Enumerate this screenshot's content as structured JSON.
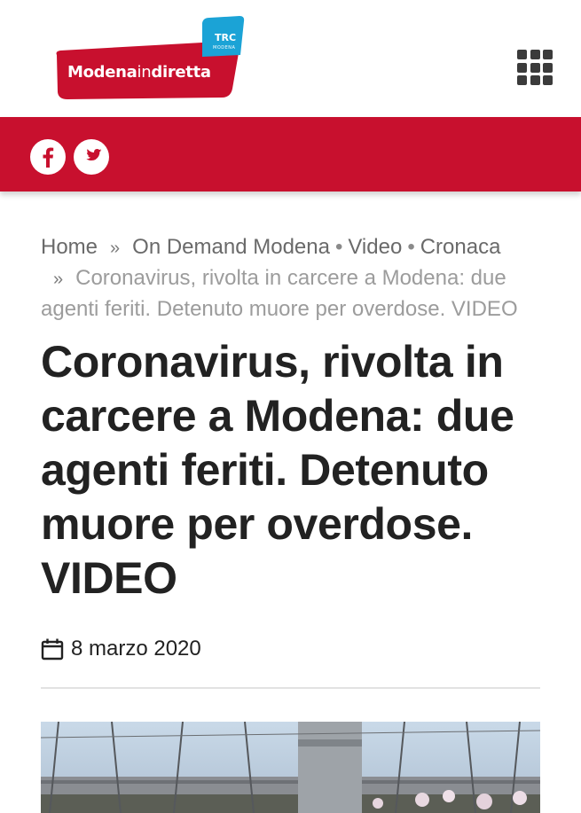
{
  "header": {
    "logo_text_bold": "Modena",
    "logo_text_light": "in",
    "logo_text_end": "diretta",
    "logo_badge": "TRC",
    "logo_badge_sub": "MODENA",
    "brand_color": "#c8102e",
    "badge_color": "#1ba3d6",
    "menu_icon": "grid-menu-icon"
  },
  "social": {
    "facebook_icon": "facebook-icon",
    "twitter_icon": "twitter-icon"
  },
  "breadcrumb": {
    "home": "Home",
    "sep1": "»",
    "cat1": "On Demand Modena",
    "dot1": "•",
    "cat2": "Video",
    "dot2": "•",
    "cat3": "Cronaca",
    "sep2": "»",
    "current": "Coronavirus, rivolta in carcere a Modena: due agenti feriti. Detenuto muore per overdose. VIDEO"
  },
  "article": {
    "title": "Coronavirus, rivolta in carcere a Modena: due agenti feriti. Detenuto muore per overdose. VIDEO",
    "date": "8 marzo 2020",
    "date_icon": "calendar-icon"
  }
}
